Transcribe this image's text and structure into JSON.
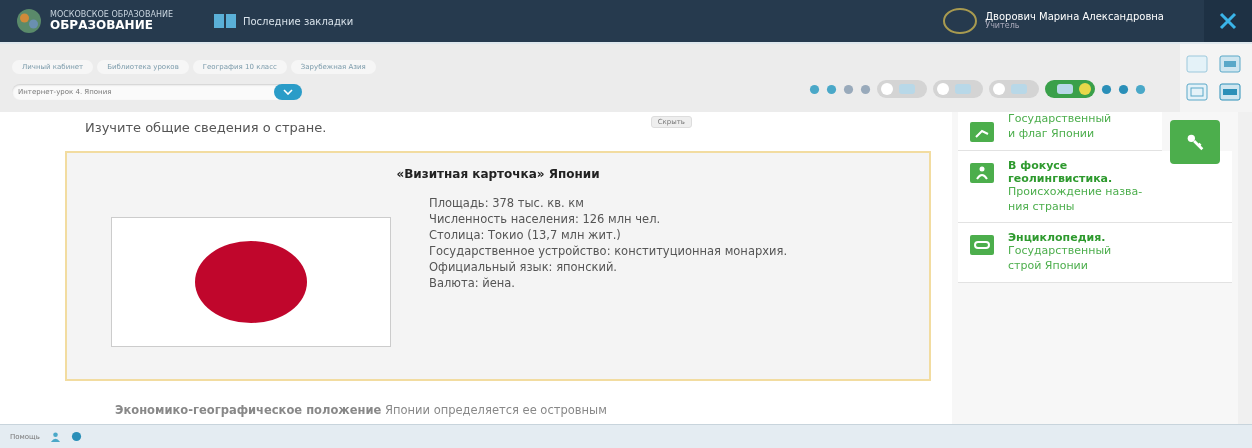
{
  "header": {
    "logo_top": "МОСКОВСКОЕ ОБРАЗОВАНИЕ",
    "logo_title": "ОБРАЗОВАНИЕ",
    "bookmarks": "Последние закладки",
    "user_name": "Дворович Марина Александровна",
    "user_role": "Учитель"
  },
  "breadcrumbs": [
    {
      "label": "Личный кабинет"
    },
    {
      "label": "Библиотека уроков"
    },
    {
      "label": "География 10 класс"
    },
    {
      "label": "Зарубежная Азия"
    }
  ],
  "lesson_select": {
    "value": "Интернет-урок 4. Япония"
  },
  "toolbar_pills": [
    {
      "selected": false
    },
    {
      "selected": false
    },
    {
      "selected": false
    },
    {
      "selected": true
    }
  ],
  "hide_button": "Скрыть",
  "intro": "Изучите общие сведения о стране.",
  "card": {
    "title": "«Визитная карточка» Японии",
    "facts": [
      "Площадь: 378 тыс. кв. км",
      "Численность населения: 126 млн чел.",
      "Столица: Токио (13,7 млн жит.)",
      "Государственное устройство: конституционная монархия.",
      "Официальный язык: японский.",
      "Валюта: йена."
    ]
  },
  "next_paragraph": "**Экономико-географическое положение** Японии определяется ее островным",
  "side_items": [
    {
      "subtitle": "Государственный\nи флаг Японии"
    },
    {
      "title": "В фокусе\nгеолингвистика.",
      "subtitle": "Происхождение назва-\nния страны"
    },
    {
      "title": "Энциклопедия.",
      "subtitle": "Государственный\nстрой Японии"
    }
  ],
  "status_bar": {
    "label": "Помощь"
  }
}
